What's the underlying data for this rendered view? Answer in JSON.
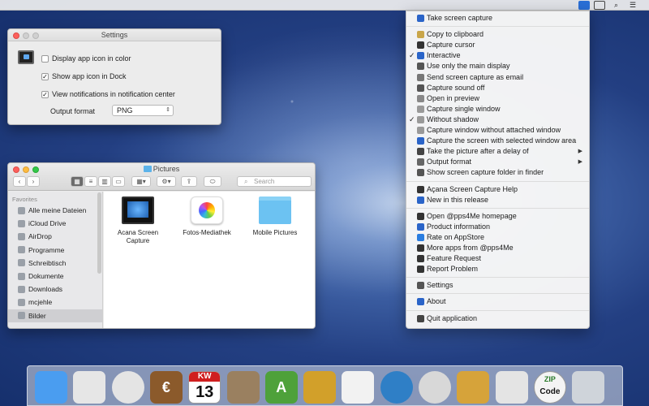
{
  "menubar": {
    "apple": "",
    "app_status_icon": "acana-screen-capture-icon",
    "extra": [
      "disk-icon",
      "search-icon",
      "list-icon"
    ]
  },
  "settings": {
    "title": "Settings",
    "options": [
      {
        "label": "Display app icon in color",
        "checked": false
      },
      {
        "label": "Show app icon in Dock",
        "checked": true
      },
      {
        "label": "View notifications in notification center",
        "checked": true
      }
    ],
    "output_format_label": "Output format",
    "output_format_value": "PNG"
  },
  "finder": {
    "title": "Pictures",
    "search_placeholder": "Search",
    "sidebar_heading": "Favorites",
    "sidebar": [
      "Alle meine Dateien",
      "iCloud Drive",
      "AirDrop",
      "Programme",
      "Schreibtisch",
      "Dokumente",
      "Downloads",
      "mcjehle",
      "Bilder"
    ],
    "selected": "Bilder",
    "items": [
      {
        "name": "Acana Screen Capture",
        "icon": "monitor-icon"
      },
      {
        "name": "Fotos-Mediathek",
        "icon": "photos-icon"
      },
      {
        "name": "Mobile Pictures",
        "icon": "folder-icon"
      }
    ]
  },
  "menu": {
    "items": [
      {
        "label": "Take screen capture",
        "icon": "acana-icon"
      },
      {
        "sep": true
      },
      {
        "label": "Copy to clipboard",
        "icon": "clipboard-icon"
      },
      {
        "label": "Capture cursor",
        "icon": "cursor-icon"
      },
      {
        "label": "Interactive",
        "icon": "acana-icon",
        "checked": true
      },
      {
        "label": "Use only the main display",
        "icon": "display-icon"
      },
      {
        "label": "Send screen capture as email",
        "icon": "email-icon"
      },
      {
        "label": "Capture sound off",
        "icon": "speaker-icon"
      },
      {
        "label": "Open in preview",
        "icon": "preview-icon"
      },
      {
        "label": "Capture single window",
        "icon": "window-icon"
      },
      {
        "label": "Without shadow",
        "icon": "window-icon",
        "checked": true
      },
      {
        "label": "Capture window without attached window",
        "icon": "window-icon"
      },
      {
        "label": "Capture the screen with selected window area",
        "icon": "acana-icon"
      },
      {
        "label": "Take the picture after a delay of",
        "icon": "clock-icon",
        "submenu": true
      },
      {
        "label": "Output format",
        "icon": "document-icon",
        "submenu": true
      },
      {
        "label": "Show screen capture folder in finder",
        "icon": "folder-icon"
      },
      {
        "sep": true
      },
      {
        "label": "Açana Screen Capture Help",
        "icon": "help-icon"
      },
      {
        "label": "New in this release",
        "icon": "acana-icon"
      },
      {
        "sep": true
      },
      {
        "label": "Open @pps4Me homepage",
        "icon": "cursor-icon"
      },
      {
        "label": "Product information",
        "icon": "info-icon"
      },
      {
        "label": "Rate on AppStore",
        "icon": "appstore-icon"
      },
      {
        "label": "More apps from @pps4Me",
        "icon": "cursor-icon"
      },
      {
        "label": "Feature Request",
        "icon": "cursor-icon"
      },
      {
        "label": "Report Problem",
        "icon": "cursor-icon"
      },
      {
        "sep": true
      },
      {
        "label": "Settings",
        "icon": "gear-icon"
      },
      {
        "sep": true
      },
      {
        "label": "About",
        "icon": "acana-icon"
      },
      {
        "sep": true
      },
      {
        "label": "Quit application",
        "icon": "power-icon"
      }
    ]
  },
  "dock": {
    "apps": [
      {
        "name": "finder-icon",
        "text": "",
        "bg": "#4a9df0"
      },
      {
        "name": "document-icon",
        "text": "",
        "bg": "#e6e6e6"
      },
      {
        "name": "car-icon",
        "text": "",
        "bg": "#e4e4e4"
      },
      {
        "name": "house-icon",
        "text": "€",
        "bg": "#8b5a2b"
      },
      {
        "name": "calendar-week-icon",
        "text": "13",
        "bg": "#ffffff"
      },
      {
        "name": "seal-icon",
        "text": "",
        "bg": "#9a8060"
      },
      {
        "name": "appstore-icon",
        "text": "A",
        "bg": "#4ea13a"
      },
      {
        "name": "hammer-icon",
        "text": "",
        "bg": "#d2a02a"
      },
      {
        "name": "calendar-icon",
        "text": "",
        "bg": "#f2f2f2"
      },
      {
        "name": "globe-icon",
        "text": "",
        "bg": "#2f7fc6"
      },
      {
        "name": "watch-icon",
        "text": "",
        "bg": "#d8d8d8"
      },
      {
        "name": "bottles-icon",
        "text": "",
        "bg": "#d6a33a"
      },
      {
        "name": "red-car-icon",
        "text": "",
        "bg": "#e4e4e4"
      },
      {
        "name": "zip-code-icon",
        "text": "Code",
        "bg": "#f4f4f4"
      },
      {
        "name": "trash-icon",
        "text": "",
        "bg": "#cfd4da"
      }
    ],
    "calendar_kw": "KW",
    "zip_text": "ZIP"
  }
}
